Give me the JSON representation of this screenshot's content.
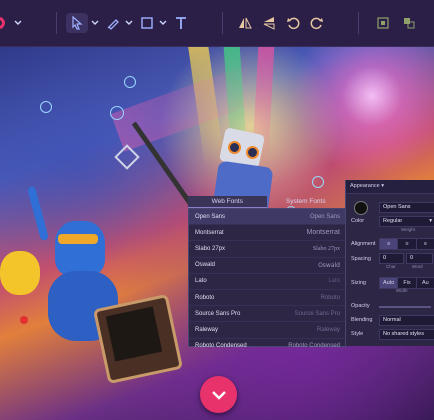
{
  "colors": {
    "accent": "#e8326c",
    "panel": "#2d2745",
    "toolbar": "#2b1f47"
  },
  "toolbar": {
    "tools": [
      "chevron-down-icon",
      "select-arrow-icon",
      "chevron-down-icon",
      "pen-icon",
      "chevron-down-icon",
      "rectangle-icon",
      "chevron-down-icon",
      "text-icon"
    ],
    "right_tools": [
      "flip-horizontal-icon",
      "flip-vertical-icon",
      "rotate-left-icon",
      "rotate-right-icon",
      "grid-icon",
      "layers-icon"
    ]
  },
  "font_picker": {
    "tabs": [
      "Web Fonts",
      "System Fonts"
    ],
    "fonts": [
      {
        "name": "Open Sans",
        "preview": "Open Sans"
      },
      {
        "name": "Montserrat",
        "preview": "Montserrat"
      },
      {
        "name": "Slabo 27px",
        "preview": "Slabo 27px"
      },
      {
        "name": "Oswald",
        "preview": "Oswald"
      },
      {
        "name": "Lato",
        "preview": "Lato"
      },
      {
        "name": "Roboto",
        "preview": "Roboto"
      },
      {
        "name": "Source Sans Pro",
        "preview": "Source Sans Pro"
      },
      {
        "name": "Raleway",
        "preview": "Raleway"
      },
      {
        "name": "Roboto Condensed",
        "preview": "Roboto Condensed"
      }
    ]
  },
  "properties": {
    "header": "Appearance",
    "font_value": "Open Sans",
    "color_label": "Color",
    "weight_value": "Regular",
    "weight_caption": "Weight",
    "alignment_label": "Alignment",
    "spacing_label": "Spacing",
    "spacing_char": "0",
    "spacing_word": "0",
    "char_caption": "Char",
    "word_caption": "Word",
    "sizing_label": "Sizing",
    "sizing_options": [
      "Auto",
      "Fix",
      "Au"
    ],
    "width_caption": "Width",
    "opacity_label": "Opacity",
    "blending_label": "Blending",
    "blending_value": "Normal",
    "style_label": "Style",
    "style_value": "No shared styles"
  }
}
